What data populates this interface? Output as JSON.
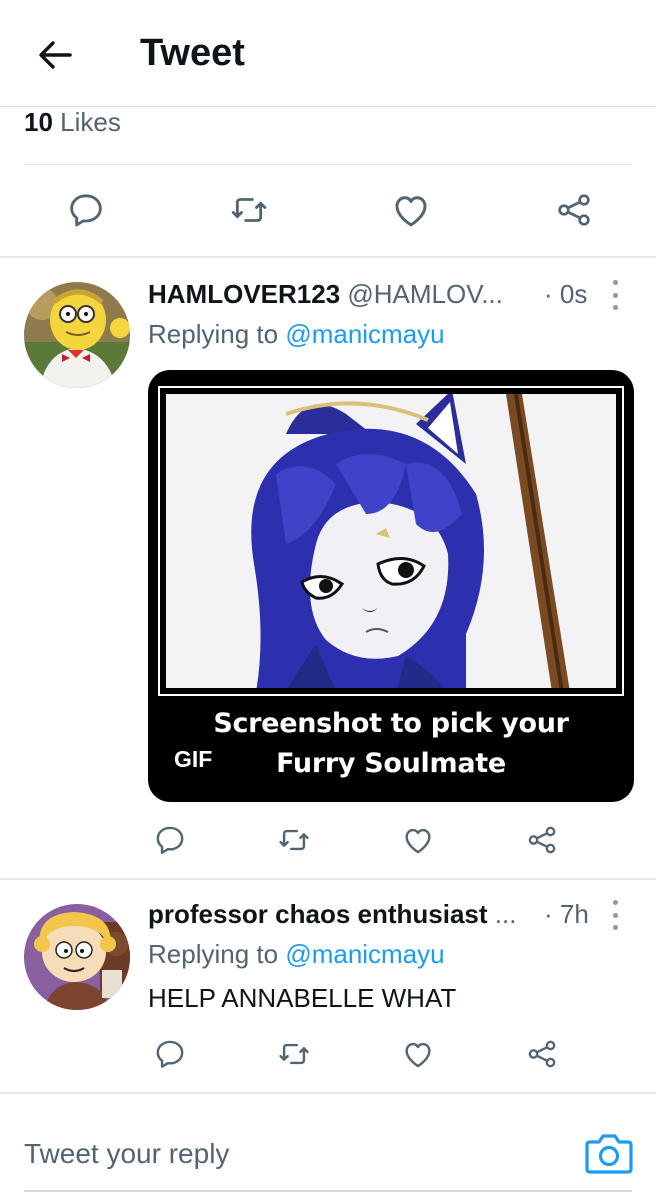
{
  "header": {
    "title": "Tweet",
    "back_icon": "arrow-left-icon"
  },
  "likes": {
    "count": "10",
    "label": "Likes"
  },
  "tweets": [
    {
      "display_name": "HAMLOVER123",
      "handle": "@HAMLOV...",
      "time": "· 0s",
      "reply_prefix": "Replying to",
      "reply_handle": "@manicmayu",
      "gif": {
        "caption_line1": "Screenshot to pick your",
        "caption_line2": "Furry Soulmate",
        "badge": "GIF"
      }
    },
    {
      "display_name": "professor chaos enthusiast",
      "handle": "...",
      "time": "· 7h",
      "reply_prefix": "Replying to",
      "reply_handle": "@manicmayu",
      "text": "HELP ANNABELLE WHAT"
    }
  ],
  "actions": {
    "icons": [
      "reply-icon",
      "retweet-icon",
      "like-icon",
      "share-icon"
    ]
  },
  "reply_bar": {
    "placeholder": "Tweet your reply",
    "camera_icon": "camera-icon"
  },
  "colors": {
    "link": "#1d9bf0",
    "secondary": "#536471",
    "primary_text": "#0f1419",
    "camera": "#1d9bf0"
  }
}
